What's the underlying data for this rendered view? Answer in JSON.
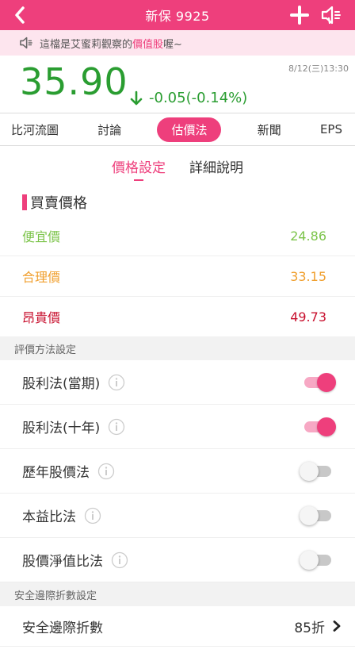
{
  "header": {
    "title": "新保 9925",
    "bg_color": "#ee3f7c"
  },
  "notice": {
    "prefix": "這檔是艾蜜莉觀察的",
    "highlight": "價值股",
    "suffix": "喔~"
  },
  "quote": {
    "price": "35.90",
    "change": "-0.05(-0.14%)",
    "datetime": "8/12(三)13:30",
    "direction": "down",
    "color": "#2a9d31"
  },
  "tabs": [
    {
      "label": "比河流圖",
      "active": false
    },
    {
      "label": "討論",
      "active": false
    },
    {
      "label": "估價法",
      "active": true
    },
    {
      "label": "新聞",
      "active": false
    },
    {
      "label": "EPS",
      "active": false
    }
  ],
  "subtabs": [
    {
      "label": "價格設定",
      "active": true
    },
    {
      "label": "詳細說明",
      "active": false
    }
  ],
  "buy_sell": {
    "title": "買賣價格",
    "items": [
      {
        "label": "便宜價",
        "value": "24.86",
        "color": "#7cc44a"
      },
      {
        "label": "合理價",
        "value": "33.15",
        "color": "#f0a030"
      },
      {
        "label": "昂貴價",
        "value": "49.73",
        "color": "#c8102e"
      }
    ]
  },
  "methods": {
    "header": "評價方法設定",
    "items": [
      {
        "label": "股利法(當期)",
        "enabled": true
      },
      {
        "label": "股利法(十年)",
        "enabled": true
      },
      {
        "label": "歷年股價法",
        "enabled": false
      },
      {
        "label": "本益比法",
        "enabled": false
      },
      {
        "label": "股價淨值比法",
        "enabled": false
      }
    ]
  },
  "safety_margin": {
    "header": "安全邊際折數設定",
    "label": "安全邊際折數",
    "value": "85折"
  },
  "icons": {
    "back": "chevron-left-icon",
    "add": "plus-icon",
    "speaker": "speaker-icon",
    "info": "info-icon",
    "chevron": "chevron-right-icon"
  }
}
